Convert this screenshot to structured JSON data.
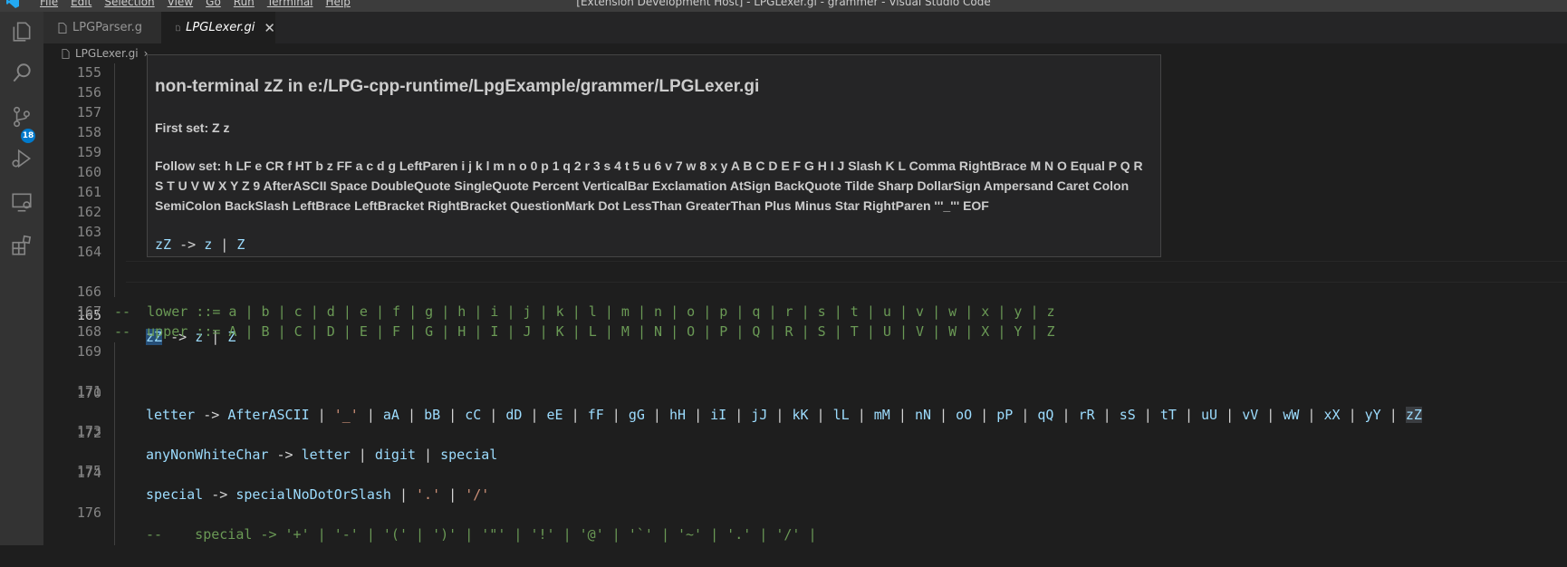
{
  "titlebar": {
    "menu": [
      "File",
      "Edit",
      "Selection",
      "View",
      "Go",
      "Run",
      "Terminal",
      "Help"
    ],
    "window_title": "[Extension Development Host] - LPGLexer.gi - grammer - Visual Studio Code"
  },
  "activitybar": {
    "items": [
      "explorer-icon",
      "search-icon",
      "source-control-icon",
      "run-debug-icon",
      "remote-explorer-icon",
      "extensions-icon"
    ],
    "source_control_badge": "18"
  },
  "tabs": [
    {
      "label": "LPGParser.g",
      "active": false
    },
    {
      "label": "LPGLexer.gi",
      "active": true,
      "close": "✕"
    }
  ],
  "breadcrumb": {
    "file": "LPGLexer.gi",
    "separator": "›",
    "rest": "..."
  },
  "hover": {
    "title": "non-terminal zZ in e:/LPG-cpp-runtime/LpgExample/grammer/LPGLexer.gi",
    "first_set": "First set: Z z",
    "follow_set": "Follow set: h LF e CR f HT b z FF a c d g LeftParen i j k l m n o 0 p 1 q 2 r 3 s 4 t 5 u 6 v 7 w 8 x y A B C D E F G H I J Slash K L Comma RightBrace M N O Equal P Q R S T U V W X Y Z 9 AfterASCII Space DoubleQuote SingleQuote Percent VerticalBar Exclamation AtSign BackQuote Tilde Sharp DollarSign Ampersand Caret Colon SemiColon BackSlash LeftBrace LeftBracket RightBracket QuestionMark Dot LessThan GreaterThan Plus Minus Star RightParen '''_''' EOF",
    "rule": "zZ -> z | Z"
  },
  "editor": {
    "current_line": "165",
    "lines": [
      {
        "num": "155",
        "text": ""
      },
      {
        "num": "156",
        "text": ""
      },
      {
        "num": "157",
        "text": ""
      },
      {
        "num": "158",
        "text": ""
      },
      {
        "num": "159",
        "text": ""
      },
      {
        "num": "160",
        "text": ""
      },
      {
        "num": "161",
        "text": ""
      },
      {
        "num": "162",
        "text": ""
      },
      {
        "num": "163",
        "text": ""
      },
      {
        "num": "164",
        "text": ""
      },
      {
        "num": "165",
        "text": "zZ -> z | Z"
      },
      {
        "num": "166",
        "text": ""
      },
      {
        "num": "167",
        "text": "--  lower ::= a | b | c | d | e | f | g | h | i | j | k | l | m | n | o | p | q | r | s | t | u | v | w | x | y | z"
      },
      {
        "num": "168",
        "text": "--  upper ::= A | B | C | D | E | F | G | H | I | J | K | L | M | N | O | P | Q | R | S | T | U | V | W | X | Y | Z"
      },
      {
        "num": "169",
        "text": ""
      },
      {
        "num": "170",
        "text": "letter -> AfterASCII | '_' | aA | bB | cC | dD | eE | fF | gG | hH | iI | jJ | kK | lL | mM | nN | oO | pP | qQ | rR | sS | tT | uU | vV | wW | xX | yY | zZ"
      },
      {
        "num": "171",
        "text": ""
      },
      {
        "num": "172",
        "text": "anyNonWhiteChar -> letter | digit | special"
      },
      {
        "num": "173",
        "text": ""
      },
      {
        "num": "174",
        "text": "special -> specialNoDotOrSlash | '.' | '/'"
      },
      {
        "num": "175",
        "text": ""
      },
      {
        "num": "176",
        "text": "--    special -> '+' | '-' | '(' | ')' | '\"' | '!' | '@' | '`' | '~' | '.' | '/' |"
      }
    ]
  }
}
